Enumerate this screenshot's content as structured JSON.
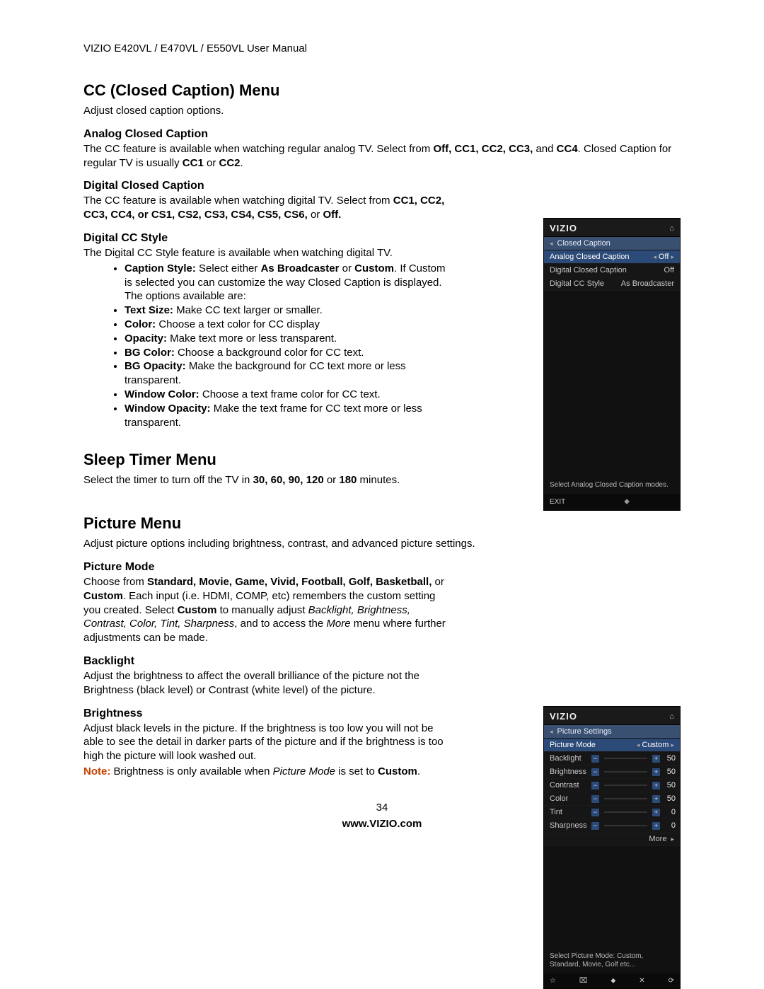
{
  "header": "VIZIO E420VL / E470VL / E550VL User Manual",
  "cc": {
    "title": "CC (Closed Caption) Menu",
    "intro": "Adjust closed caption options.",
    "analog": {
      "heading": "Analog Closed Caption",
      "p1a": "The CC feature is available when watching regular analog TV. Select from ",
      "p1b": "Off, CC1, CC2, CC3, ",
      "p1c": "and ",
      "p1d": "CC4",
      "p1e": ". Closed Caption for regular TV is usually ",
      "p1f": "CC1",
      "p1g": " or ",
      "p1h": "CC2",
      "p1i": "."
    },
    "digital": {
      "heading": "Digital Closed Caption",
      "p1a": "The CC feature is available when watching digital TV. Select from ",
      "p1b": "CC1, CC2, CC3, CC4, or CS1, CS2, CS3, CS4, CS5, CS6, ",
      "p1c": "or ",
      "p1d": "Off."
    },
    "style": {
      "heading": "Digital CC Style",
      "intro": "The Digital CC Style feature is available when watching digital TV.",
      "li1a": "Caption Style:",
      "li1b": " Select either ",
      "li1c": "As Broadcaster",
      "li1d": " or ",
      "li1e": "Custom",
      "li1f": ". If Custom is selected you can customize the way Closed Caption is displayed. The options available are:",
      "li2a": "Text Size:",
      "li2b": " Make CC text larger or smaller.",
      "li3a": "Color:",
      "li3b": " Choose a text color for CC display",
      "li4a": "Opacity:",
      "li4b": " Make text more or less transparent.",
      "li5a": "BG Color:",
      "li5b": " Choose a background color for CC text.",
      "li6a": "BG Opacity:",
      "li6b": " Make the background for CC text more or less transparent.",
      "li7a": "Window Color:",
      "li7b": " Choose a text frame color for CC text.",
      "li8a": "Window Opacity:",
      "li8b": " Make the text frame for CC text more or less transparent."
    }
  },
  "sleep": {
    "title": "Sleep Timer Menu",
    "p1a": "Select the timer to turn off the TV in ",
    "p1b": "30, 60, 90, 120",
    "p1c": " or ",
    "p1d": "180",
    "p1e": " minutes."
  },
  "picture": {
    "title": "Picture Menu",
    "intro": "Adjust picture options including brightness, contrast, and advanced picture settings.",
    "mode": {
      "heading": "Picture Mode",
      "p1a": "Choose from ",
      "p1b": "Standard, Movie, Game, Vivid, Football, Golf, Basketball, ",
      "p1c": "or ",
      "p1d": "Custom",
      "p1e": ". Each input (i.e. HDMI, COMP, etc) remembers the custom setting you created. Select ",
      "p1f": "Custom",
      "p1g": " to manually adjust ",
      "p1h": "Backlight, Brightness, Contrast, Color, Tint, Sharpness",
      "p1i": ", and to access the ",
      "p1j": "More",
      "p1k": " menu where further adjustments can be made."
    },
    "backlight": {
      "heading": "Backlight",
      "body": "Adjust the brightness to affect the overall brilliance of the picture not the Brightness (black level) or Contrast (white level) of the picture."
    },
    "brightness": {
      "heading": "Brightness",
      "body": "Adjust black levels in the picture. If the brightness is too low you will not be able to see the detail in darker parts of the picture and if the brightness is too high the picture will look washed out.",
      "note_lead": "Note:",
      "note_a": " Brightness is only available when ",
      "note_b": "Picture Mode",
      "note_c": " is set to ",
      "note_d": "Custom",
      "note_e": "."
    }
  },
  "footer": {
    "page": "34",
    "site": "www.VIZIO.com"
  },
  "tv_cc": {
    "brand": "VIZIO",
    "bc_arrow": "◂",
    "breadcrumb": "Closed Caption",
    "rows": [
      {
        "label": "Analog Closed Caption",
        "value": "Off",
        "selected": true,
        "arrows": true
      },
      {
        "label": "Digital Closed Caption",
        "value": "Off",
        "selected": false,
        "arrows": false
      },
      {
        "label": "Digital CC Style",
        "value": "As Broadcaster",
        "selected": false,
        "arrows": false
      }
    ],
    "desc": "Select Analog Closed Caption modes.",
    "exit": "EXIT"
  },
  "tv_pic": {
    "brand": "VIZIO",
    "bc_arrow": "◂",
    "breadcrumb": "Picture Settings",
    "mode_label": "Picture Mode",
    "mode_value": "Custom",
    "sliders": [
      {
        "label": "Backlight",
        "value": "50"
      },
      {
        "label": "Brightness",
        "value": "50"
      },
      {
        "label": "Contrast",
        "value": "50"
      },
      {
        "label": "Color",
        "value": "50"
      },
      {
        "label": "Tint",
        "value": "0"
      },
      {
        "label": "Sharpness",
        "value": "0"
      }
    ],
    "more": "More",
    "desc": "Select Picture Mode: Custom, Standard, Movie, Golf etc...",
    "foot_icons": [
      "☆",
      "⌧",
      "⬥",
      "✕",
      "⟳"
    ]
  }
}
